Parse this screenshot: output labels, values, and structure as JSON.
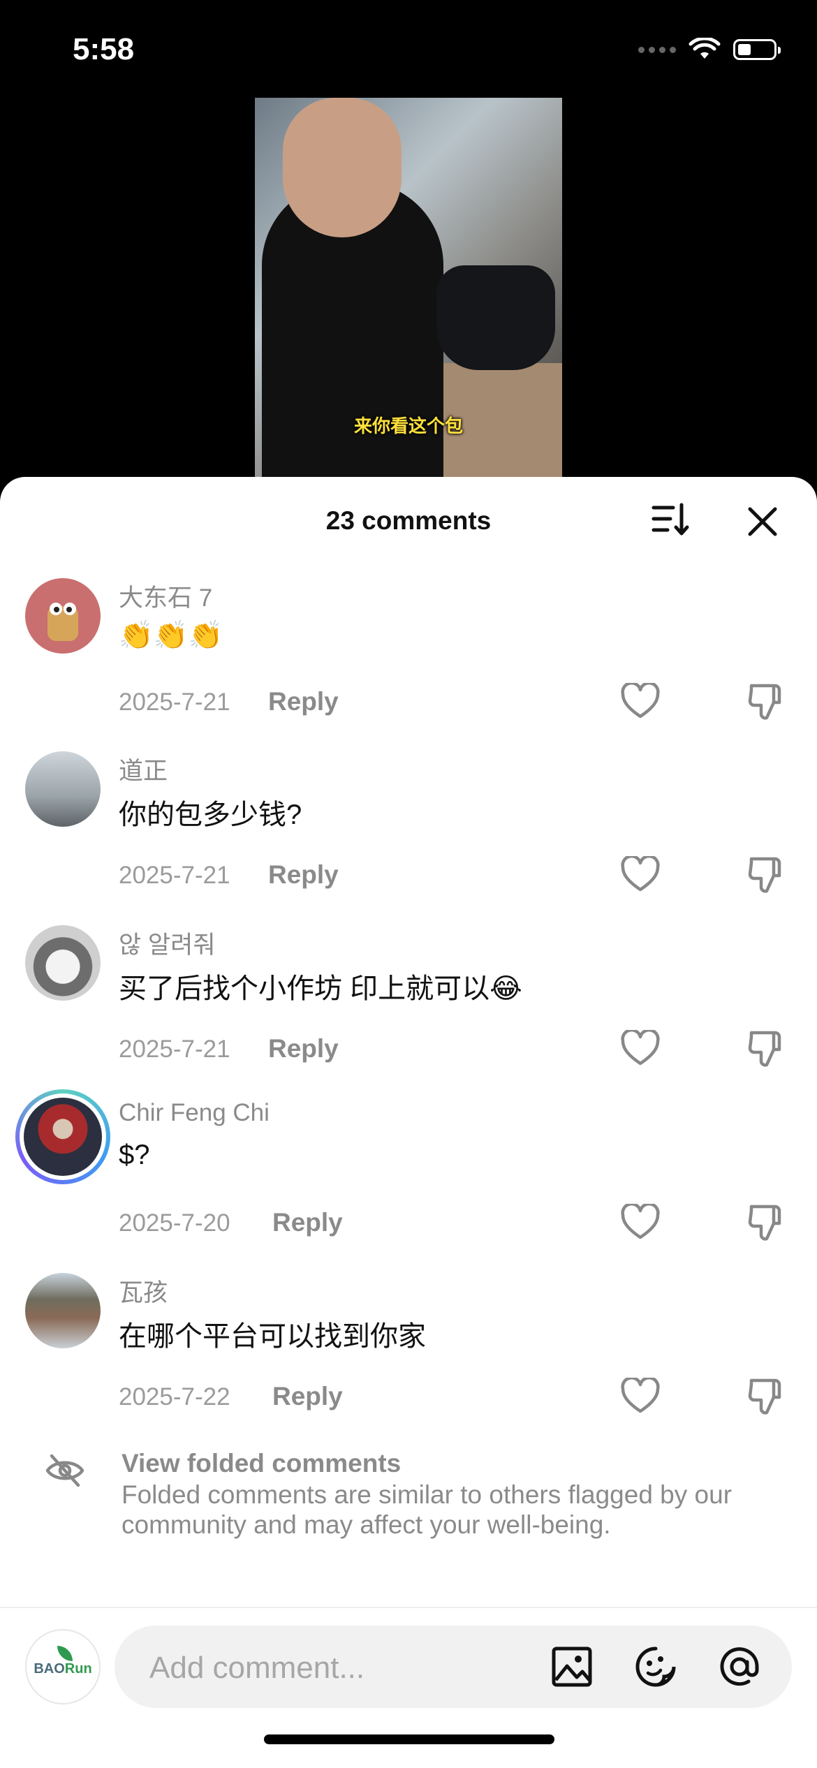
{
  "status": {
    "time": "5:58"
  },
  "video": {
    "caption": "来你看这个包"
  },
  "sheet": {
    "title": "23 comments",
    "sort_icon": "sort-icon",
    "close_icon": "close-icon"
  },
  "comments": [
    {
      "username": "大东石 7",
      "text": "👏👏👏",
      "date": "2025-7-21",
      "reply_label": "Reply"
    },
    {
      "username": "道正",
      "text": "你的包多少钱?",
      "date": "2025-7-21",
      "reply_label": "Reply"
    },
    {
      "username": "않 알려줘",
      "text": "买了后找个小作坊 印上就可以😂",
      "date": "2025-7-21",
      "reply_label": "Reply"
    },
    {
      "username": "Chir Feng Chi",
      "text": "$?",
      "date": "2025-7-20",
      "reply_label": "Reply"
    },
    {
      "username": "瓦孩",
      "text": "在哪个平台可以找到你家",
      "date": "2025-7-22",
      "reply_label": "Reply"
    }
  ],
  "folded": {
    "title": "View folded comments",
    "description": "Folded comments are similar to others flagged by our community and may affect your well-being."
  },
  "composer": {
    "placeholder": "Add comment...",
    "avatar_logo_left": "BAO",
    "avatar_logo_right": "Run"
  }
}
